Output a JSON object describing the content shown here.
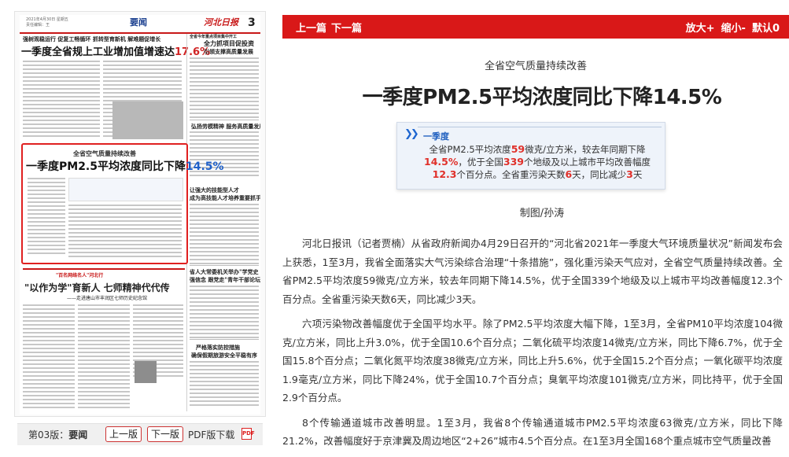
{
  "paper": {
    "masthead_meta": "2021年4月30日 星期五",
    "masthead_meta2": "责任编辑：王",
    "section": "要闻",
    "brand": "河北日报",
    "page_number": "3",
    "headline1_sub": "强树观稳运行 促复工畅循环 抓转型育新机 解难题促增长",
    "headline1_main": "一季度全省规上工业增加值增速达",
    "headline1_value": "17.6%",
    "right_kicker": "全省今年重点项目集中开工",
    "right_head1": "全力抓项目促投资",
    "right_head2": "引领支撑高质量发展",
    "mid_right_head": "弘扬劳模精神 服务高质量发展",
    "highlight_kicker": "全省空气质量持续改善",
    "highlight_title": "一季度PM2.5平均浓度同比下降",
    "highlight_value": "14.5%",
    "right_head3": "让强大的技能型人才",
    "right_head4": "成为高技能人才培养重要抓手",
    "band_label": "\"百名网络名人\"河北行",
    "lower_head": "\"以作为学\"育新人 七师精神代代传",
    "lower_sub": "——走进唐山市丰润区七师历史纪念馆",
    "right_head5": "省人大常委机关举办\"学党史",
    "right_head6": "强信念 跟党走\"青年干部论坛",
    "right_head7": "严格落实防控措施",
    "right_head8": "确保假期旅游安全平稳有序"
  },
  "pager": {
    "prefix": "第03版：",
    "section": "要闻",
    "prev": "上一版",
    "next": "下一版",
    "pdf": "PDF版下载",
    "pdf_icon": "PDF"
  },
  "topbar": {
    "prev": "上一篇",
    "next": "下一篇",
    "zoom_in": "放大+",
    "zoom_out": "缩小-",
    "default": "默认0"
  },
  "article": {
    "kicker": "全省空气质量持续改善",
    "title": "一季度PM2.5平均浓度同比下降14.5%",
    "card": {
      "heading": "一季度",
      "t1": "全省PM2.5平均浓度",
      "v1": "59",
      "t2": "微克/立方米，较去年同期下降",
      "v2": "14.5%",
      "t3": "，优于全国",
      "v3": "339",
      "t4": "个地级及以上城市平均改善幅度",
      "v4": "12.3",
      "t5": "个百分点。全省重污染天数",
      "v5": "6",
      "t6": "天，同比减少",
      "v6": "3",
      "t7": "天"
    },
    "credit": "制图/孙涛",
    "paragraphs": [
      "河北日报讯（记者贾楠）从省政府新闻办4月29日召开的“河北省2021年一季度大气环境质量状况”新闻发布会上获悉，1至3月，我省全面落实大气污染综合治理“十条措施”，强化重污染天气应对，全省空气质量持续改善。全省PM2.5平均浓度59微克/立方米，较去年同期下降14.5%，优于全国339个地级及以上城市平均改善幅度12.3个百分点。全省重污染天数6天，同比减少3天。",
      "六项污染物改善幅度优于全国平均水平。除了PM2.5平均浓度大幅下降，1至3月，全省PM10平均浓度104微克/立方米，同比上升3.0%，优于全国10.6个百分点；二氧化硫平均浓度14微克/立方米，同比下降6.7%，优于全国15.8个百分点；二氧化氮平均浓度38微克/立方米，同比上升5.6%，优于全国15.2个百分点；一氧化碳平均浓度1.9毫克/立方米，同比下降24%，优于全国10.7个百分点；臭氧平均浓度101微克/立方米，同比持平，优于全国2.9个百分点。",
      "8个传输通道城市改善明显。1至3月，我省8个传输通道城市PM2.5平均浓度63微克/立方米，同比下降21.2%，改善幅度好于京津冀及周边地区“2+26”城市4.5个百分点。在1至3月全国168个重点城市空气质量改善"
    ]
  }
}
